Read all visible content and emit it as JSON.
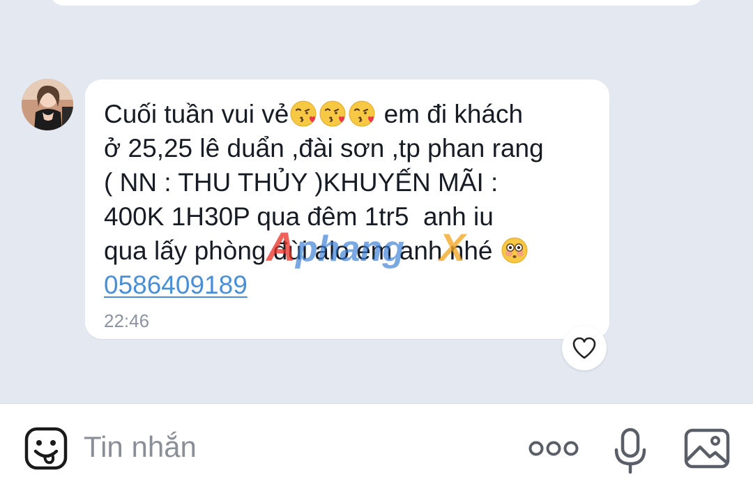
{
  "message": {
    "line1_start": "Cuối tuần vui vẻ",
    "line1_end": " em đi khách",
    "line2": "ở 25,25 lê duẩn ,đài sơn ,tp phan rang",
    "line3": "( NN : THU THỦY )KHUYẾN MÃI :",
    "line4": "400K 1H30P qua đêm 1tr5  anh iu",
    "line5": "qua lấy phòng đùi alo em anh nhé ",
    "phone": "0586409189",
    "time": "22:46",
    "emojis": [
      "kissing-heart-emoji",
      "kissing-heart-emoji",
      "kissing-heart-emoji",
      "flushed-emoji"
    ]
  },
  "watermark": {
    "text": "Aphangx",
    "colors": [
      "#e8342a",
      "#3a7fd6",
      "#f4a623"
    ]
  },
  "input_bar": {
    "placeholder": "Tin nhắn",
    "icons": [
      "sticker-icon",
      "more-icon",
      "mic-icon",
      "image-icon"
    ]
  },
  "colors": {
    "chat_background": "#e3e8f1",
    "bubble": "#ffffff",
    "link": "#4a8fd6",
    "timestamp": "#8c93a0"
  }
}
